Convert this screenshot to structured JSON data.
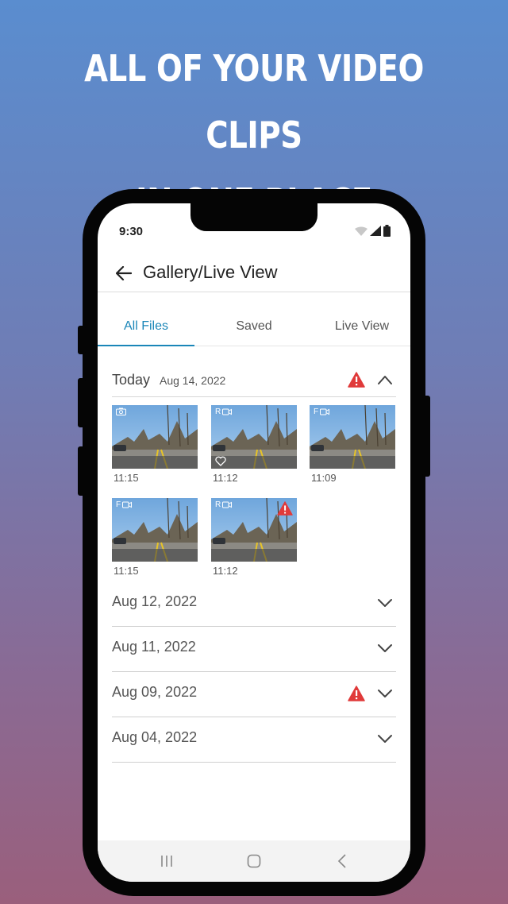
{
  "headline": {
    "line1": "ALL OF YOUR VIDEO CLIPS",
    "line2": "IN ONE PLACE"
  },
  "status_bar": {
    "time": "9:30",
    "icons": [
      "wifi-icon",
      "signal-icon",
      "battery-icon"
    ]
  },
  "app_bar": {
    "title": "Gallery/Live View",
    "back_icon": "arrow-left-icon"
  },
  "tabs": [
    {
      "label": "All Files",
      "active": true
    },
    {
      "label": "Saved",
      "active": false
    },
    {
      "label": "Live View",
      "active": false
    }
  ],
  "today_section": {
    "label": "Today",
    "date": "Aug 14, 2022",
    "has_alert": true,
    "expanded": true,
    "clips": [
      {
        "time": "11:15",
        "badge": "camera-icon",
        "favorite": false,
        "alert": false
      },
      {
        "time": "11:12",
        "badge": "R",
        "badge_icon": "video-icon",
        "favorite": true,
        "alert": false
      },
      {
        "time": "11:09",
        "badge": "F",
        "badge_icon": "video-icon",
        "favorite": false,
        "alert": false
      },
      {
        "time": "11:15",
        "badge": "F",
        "badge_icon": "video-icon",
        "favorite": false,
        "alert": false
      },
      {
        "time": "11:12",
        "badge": "R",
        "badge_icon": "video-icon",
        "favorite": false,
        "alert": true
      }
    ]
  },
  "date_groups": [
    {
      "label": "Aug 12, 2022",
      "has_alert": false
    },
    {
      "label": "Aug 11, 2022",
      "has_alert": false
    },
    {
      "label": "Aug 09, 2022",
      "has_alert": true
    },
    {
      "label": "Aug 04, 2022",
      "has_alert": false
    }
  ],
  "nav_bar": {
    "icons": [
      "recent-apps-icon",
      "home-icon",
      "back-icon"
    ]
  },
  "colors": {
    "accent": "#1a86b8",
    "alert": "#e03a3a",
    "background_top": "#5a8dcf",
    "background_bottom": "#9a5f7c"
  }
}
